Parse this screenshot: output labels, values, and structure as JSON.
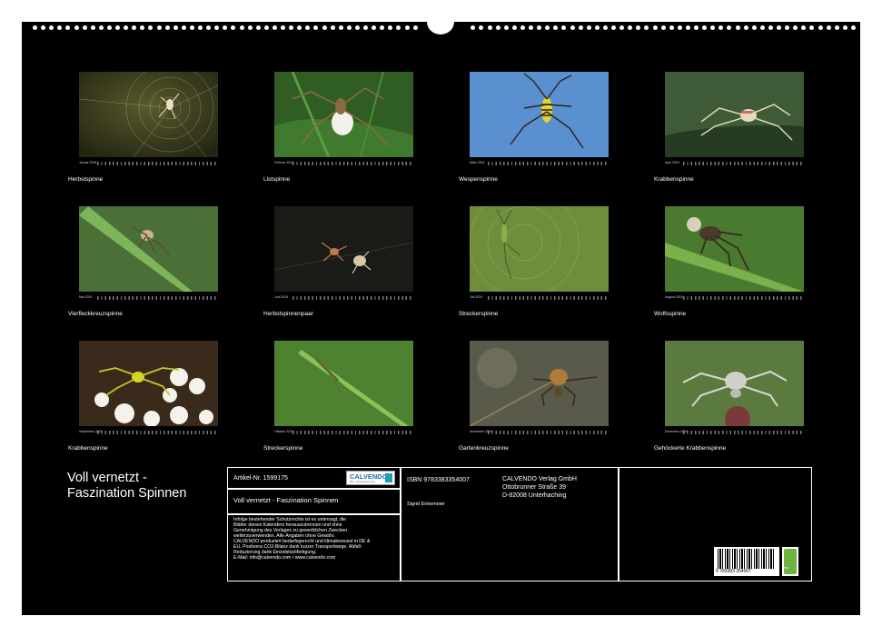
{
  "colors": {
    "background": "#000000",
    "text": "#ffffff",
    "page": "#ffffff"
  },
  "months": [
    {
      "month": "Januar 2024",
      "caption": "Herbstspinne"
    },
    {
      "month": "Februar 2024",
      "caption": "Listspinne"
    },
    {
      "month": "März 2024",
      "caption": "Wespenspinne"
    },
    {
      "month": "April 2024",
      "caption": "Krabbenspinne"
    },
    {
      "month": "Mai 2024",
      "caption": "Vierfleckkreuzspinne"
    },
    {
      "month": "Juni 2024",
      "caption": "Herbstspinnenpaar"
    },
    {
      "month": "Juli 2024",
      "caption": "Streckerspinne"
    },
    {
      "month": "August 2024",
      "caption": "Wolfsspinne"
    },
    {
      "month": "September 2024",
      "caption": "Krabbenspinne"
    },
    {
      "month": "Oktober 2024",
      "caption": "Streckerspinne"
    },
    {
      "month": "November 2024",
      "caption": "Gartenkreuzspinne"
    },
    {
      "month": "Dezember 2024",
      "caption": "Gehöckerte Krabbenspinne"
    }
  ],
  "title_line1": "Voll vernetzt -",
  "title_line2": "Faszination Spinnen",
  "info": {
    "article": "Artikel-Nr. 1599175",
    "logo": "CALVENDO",
    "logo_sub": "Bild- und Kalenderverlag",
    "subtitle": "Voll vernetzt - Faszination Spinnen",
    "legal": [
      "Infolge bestehender Schutzrechte ist es untersagt, die",
      "Blätter dieses Kalenders herauszutrennen und ohne",
      "Genehmigung des Verlages zu gewerblichen Zwecken",
      "weiterzuverwenden. Alle Angaben ohne Gewähr.",
      "CALVENDO produziert bedarfsgerecht und klimabewusst in DE &",
      "EU. Posbvera CO2-Bilanz dank kurzer Transportwege. Abfall-",
      "Reduzierung dank Einzelstückfertigung.",
      "E-Mail: info@calvendo.com • www.calvendo.com"
    ],
    "isbn": "ISBN 9783383354007",
    "publisher": "CALVENDO Verlag GmbH",
    "street": "Ottobrunner Straße 39",
    "city": "D-82008 Unterhaching",
    "author": "Sigrid Enkemeier",
    "barcode_text": "9 783383 354007",
    "eco_text": "eco"
  }
}
